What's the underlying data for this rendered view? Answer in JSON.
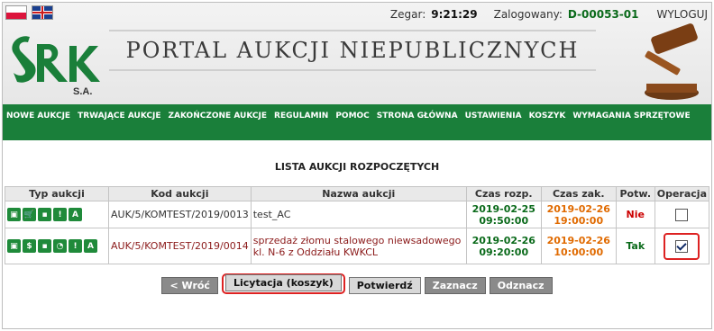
{
  "header": {
    "clock_label": "Zegar:",
    "clock_value": "9:21:29",
    "logged_label": "Zalogowany:",
    "user_id": "D-00053-01",
    "logout": "WYLOGUJ",
    "portal_title": "PORTAL AUKCJI NIEPUBLICZNYCH",
    "logo_text": "SRK",
    "logo_sub": "S.A."
  },
  "nav": [
    "NOWE AUKCJE",
    "TRWAJĄCE AUKCJE",
    "ZAKOŃCZONE AUKCJE",
    "REGULAMIN",
    "POMOC",
    "STRONA GŁÓWNA",
    "USTAWIENIA",
    "KOSZYK",
    "WYMAGANIA SPRZĘTOWE"
  ],
  "section_title": "LISTA AUKCJI ROZPOCZĘTYCH",
  "table": {
    "headers": [
      "Typ aukcji",
      "Kod aukcji",
      "Nazwa aukcji",
      "Czas rozp.",
      "Czas zak.",
      "Potw.",
      "Operacja"
    ],
    "rows": [
      {
        "icons": [
          "▣",
          "🛒",
          "▪",
          "!",
          "A"
        ],
        "code": "AUK/5/KOMTEST/2019/0013",
        "name": "test_AC",
        "start_date": "2019-02-25",
        "start_time": "09:50:00",
        "end_date": "2019-02-26",
        "end_time": "19:00:00",
        "confirm": "Nie",
        "checked": false
      },
      {
        "icons": [
          "▣",
          "$",
          "▪",
          "◔",
          "!",
          "A"
        ],
        "code": "AUK/5/KOMTEST/2019/0014",
        "name": "sprzedaż złomu stalowego niewsadowego kl. N-6 z Oddziału KWKCL",
        "start_date": "2019-02-26",
        "start_time": "09:20:00",
        "end_date": "2019-02-26",
        "end_time": "10:00:00",
        "confirm": "Tak",
        "checked": true
      }
    ]
  },
  "buttons": {
    "back": "< Wróć",
    "licytacja": "Licytacja (koszyk)",
    "confirm": "Potwierdź",
    "select_all": "Zaznacz",
    "deselect_all": "Odznacz"
  }
}
